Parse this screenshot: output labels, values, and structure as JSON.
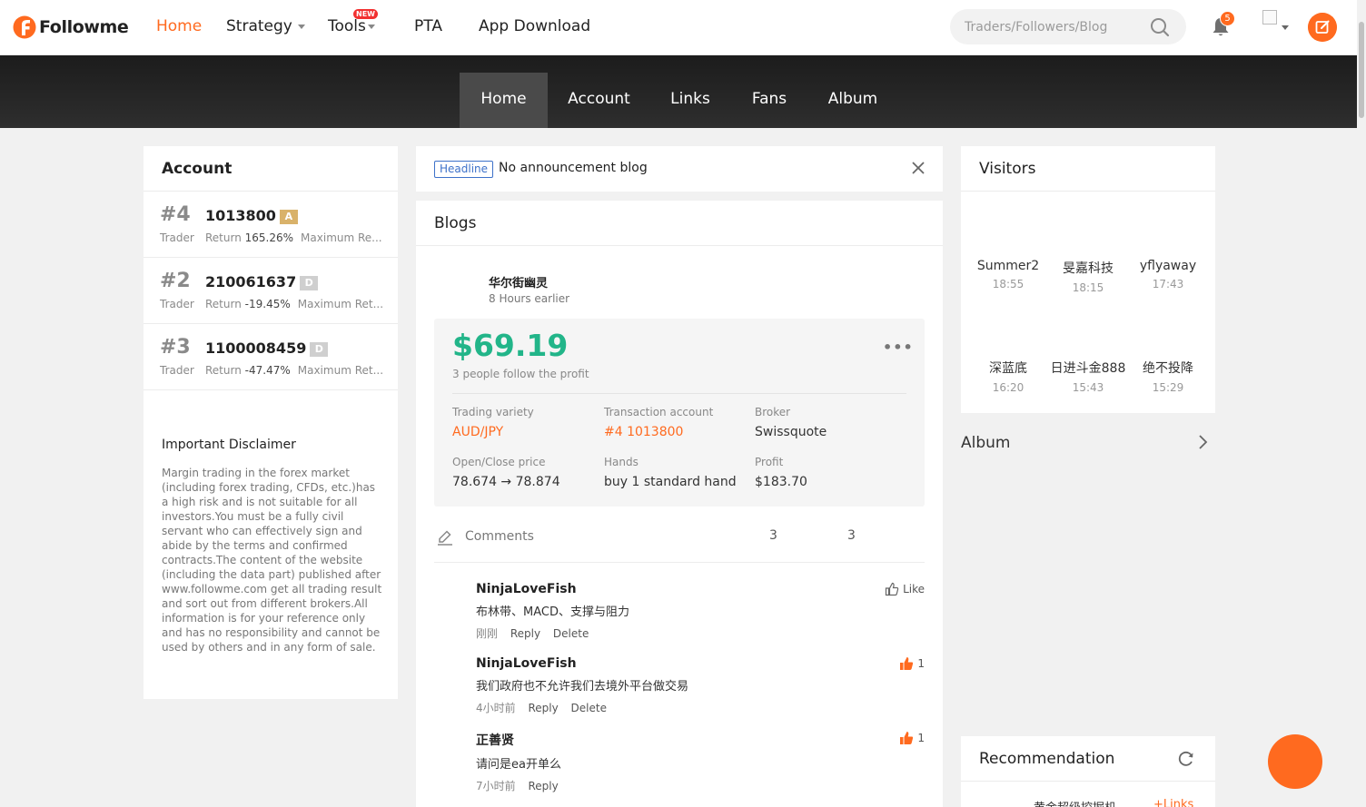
{
  "nav": {
    "logo": "Followme",
    "items": [
      {
        "label": "Home",
        "active": true
      },
      {
        "label": "Strategy",
        "dropdown": true
      },
      {
        "label": "Tools",
        "badge": "NEW",
        "dropdown": true
      },
      {
        "label": "PTA"
      },
      {
        "label": "App Download"
      }
    ],
    "search_placeholder": "Traders/Followers/Blog",
    "notification_count": "5",
    "accent_color": "#ff6a1f"
  },
  "profile_tabs": [
    "Home",
    "Account",
    "Links",
    "Fans",
    "Album"
  ],
  "account": {
    "title": "Account",
    "rows": [
      {
        "rank": "#4",
        "role": "Trader",
        "id": "1013800",
        "grade": "A",
        "return_label": "Return",
        "return_value": "165.26%",
        "max": "Maximum Re..."
      },
      {
        "rank": "#2",
        "role": "Trader",
        "id": "210061637",
        "grade": "D",
        "return_label": "Return",
        "return_value": "-19.45%",
        "max": "Maximum Ret..."
      },
      {
        "rank": "#3",
        "role": "Trader",
        "id": "1100008459",
        "grade": "D",
        "return_label": "Return",
        "return_value": "-47.47%",
        "max": "Maximum Ret..."
      }
    ],
    "disclaimer_title": "Important Disclaimer",
    "disclaimer_text": "Margin trading in the forex market (including forex trading, CFDs, etc.)has a high risk and is not suitable for all investors.You must be a fully civil servant who can effectively sign and abide by the terms and confirmed contracts.The content of the website (including the data part) published after www.followme.com get all trading result and sort out from different brokers.All information is for your reference only and has no responsibility and cannot be used by others and in any form of sale."
  },
  "headline": {
    "tag": "Headline",
    "text": "No announcement blog"
  },
  "blogs": {
    "title": "Blogs",
    "author": "华尔街幽灵",
    "time": "8 Hours earlier",
    "profit": "$69.19",
    "followers_text": "3 people follow the profit",
    "fields": {
      "variety_label": "Trading variety",
      "variety": "AUD/JPY",
      "account_label": "Transaction account",
      "account": "#4 1013800",
      "broker_label": "Broker",
      "broker": "Swissquote",
      "price_label": "Open/Close price",
      "price": "78.674 → 78.874",
      "hands_label": "Hands",
      "hands": "buy 1 standard hand",
      "profit_label": "Profit",
      "profit_value": "$183.70"
    },
    "comments_label": "Comments",
    "count_a": "3",
    "count_b": "3",
    "comments": [
      {
        "user": "NinjaLoveFish",
        "text": "布林带、MACD、支撑与阻力",
        "time": "刚刚",
        "reply": "Reply",
        "delete": "Delete",
        "like": "Like",
        "liked": false
      },
      {
        "user": "NinjaLoveFish",
        "text": "我们政府也不允许我们去境外平台做交易",
        "time": "4小时前",
        "reply": "Reply",
        "delete": "Delete",
        "like": "1",
        "liked": true
      },
      {
        "user": "正善贤",
        "text": "请问是ea开单么",
        "time": "7小时前",
        "reply": "Reply",
        "like": "1",
        "liked": true
      }
    ]
  },
  "visitors": {
    "title": "Visitors",
    "list": [
      {
        "name": "Summer2",
        "time": "18:55"
      },
      {
        "name": "旻嘉科技",
        "time": "18:15"
      },
      {
        "name": "yflyaway",
        "time": "17:43"
      },
      {
        "name": "深蓝底",
        "time": "16:20"
      },
      {
        "name": "日进斗金888",
        "time": "15:43"
      },
      {
        "name": "绝不投降",
        "time": "15:29"
      }
    ]
  },
  "album": {
    "title": "Album"
  },
  "recommendation": {
    "title": "Recommendation",
    "partial_name": "黄金超级挖掘机",
    "partial_link": "+Links"
  }
}
